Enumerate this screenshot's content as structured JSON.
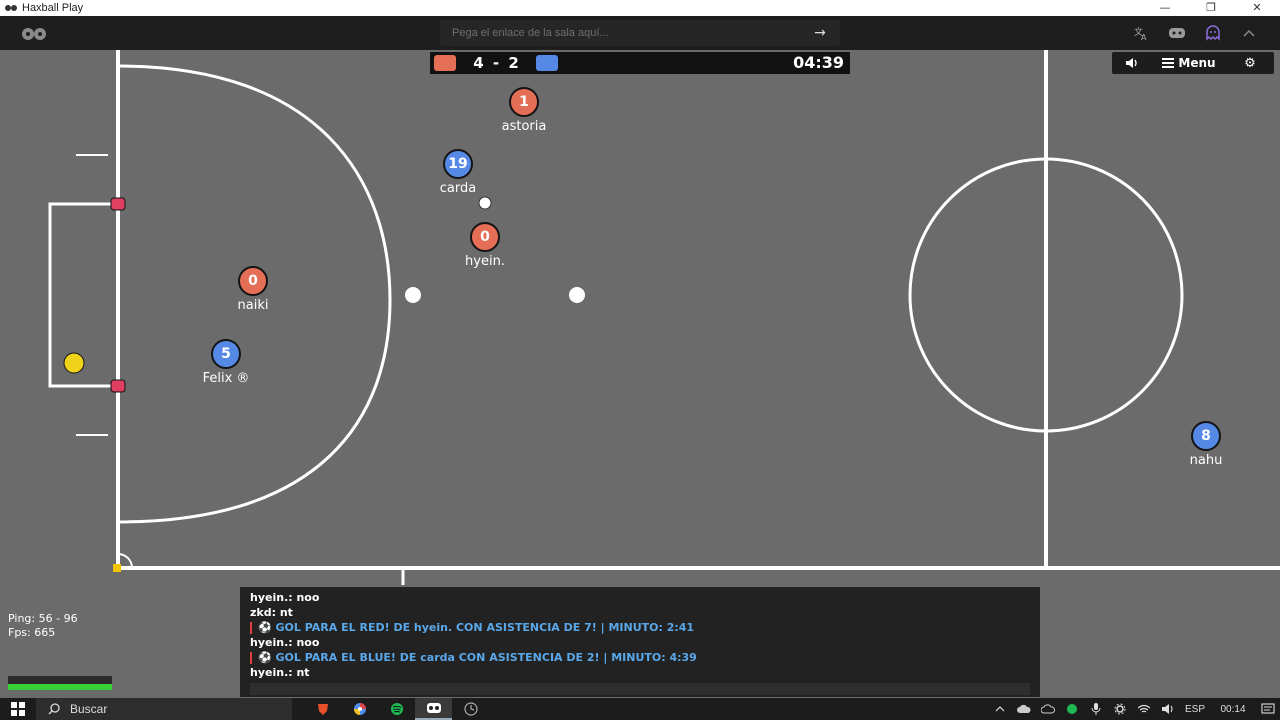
{
  "window": {
    "title": "Haxball Play",
    "minimize": "—",
    "restore": "❐",
    "close": "✕"
  },
  "topbar": {
    "room_link_placeholder": "Pega el enlace de la sala aquí...",
    "go_arrow": "→",
    "icons": [
      "translate-icon",
      "discord-icon",
      "ghost-icon",
      "chevron-up-icon"
    ]
  },
  "scoreboard": {
    "score": "4 - 2",
    "time": "04:39",
    "red_color": "#e56e56",
    "blue_color": "#5689e5"
  },
  "controls": {
    "menu_label": "Menu",
    "gear_glyph": "⚙"
  },
  "players": [
    {
      "number": "1",
      "name": "astoria",
      "team": "red"
    },
    {
      "number": "19",
      "name": "carda",
      "team": "blue"
    },
    {
      "number": "0",
      "name": "hyein.",
      "team": "red"
    },
    {
      "number": "0",
      "name": "naiki",
      "team": "red"
    },
    {
      "number": "5",
      "name": "Felix ®",
      "team": "blue"
    },
    {
      "number": "8",
      "name": "nahu",
      "team": "blue"
    }
  ],
  "stats": {
    "ping": "Ping: 56 - 96",
    "fps": "Fps: 665"
  },
  "chat": {
    "messages": [
      {
        "text": "hyein.: noo",
        "type": "normal"
      },
      {
        "text": "zkd: nt",
        "type": "normal"
      },
      {
        "text": "⚽ GOL PARA EL RED! DE hyein. CON ASISTENCIA DE 7! | MINUTO: 2:41",
        "type": "announce"
      },
      {
        "text": "hyein.: noo",
        "type": "normal"
      },
      {
        "text": "⚽ GOL PARA EL BLUE! DE carda CON ASISTENCIA DE 2! | MINUTO: 4:39",
        "type": "announce"
      },
      {
        "text": "hyein.: nt",
        "type": "normal"
      }
    ]
  },
  "taskbar": {
    "search_label": "Buscar",
    "language": "ESP",
    "clock": "00:14"
  }
}
